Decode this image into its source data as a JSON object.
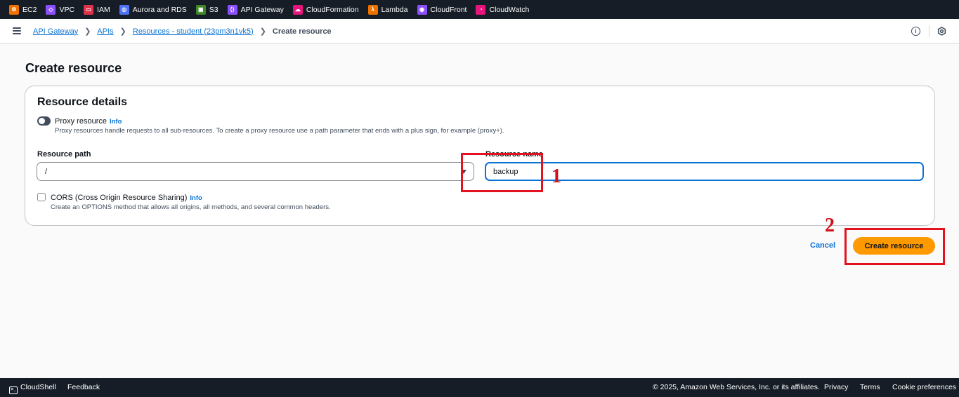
{
  "favorites": [
    {
      "label": "EC2",
      "icon": "ec2-icon",
      "color": "#ed7100"
    },
    {
      "label": "VPC",
      "icon": "vpc-icon",
      "color": "#8c4fff"
    },
    {
      "label": "IAM",
      "icon": "iam-icon",
      "color": "#dd344c"
    },
    {
      "label": "Aurora and RDS",
      "icon": "rds-icon",
      "color": "#4d72f3"
    },
    {
      "label": "S3",
      "icon": "s3-icon",
      "color": "#3f8624"
    },
    {
      "label": "API Gateway",
      "icon": "api-gateway-icon",
      "color": "#8c4fff"
    },
    {
      "label": "CloudFormation",
      "icon": "cloudformation-icon",
      "color": "#e7157b"
    },
    {
      "label": "Lambda",
      "icon": "lambda-icon",
      "color": "#ed7100"
    },
    {
      "label": "CloudFront",
      "icon": "cloudfront-icon",
      "color": "#8c4fff"
    },
    {
      "label": "CloudWatch",
      "icon": "cloudwatch-icon",
      "color": "#e7157b"
    }
  ],
  "breadcrumb": {
    "api_gateway": "API Gateway",
    "apis": "APIs",
    "resources": "Resources - student (23pm3n1vk5)",
    "current": "Create resource"
  },
  "page": {
    "title": "Create resource"
  },
  "resource_details": {
    "title": "Resource details",
    "proxy_label": "Proxy resource",
    "proxy_info": "Info",
    "proxy_desc": "Proxy resources handle requests to all sub-resources. To create a proxy resource use a path parameter that ends with a plus sign, for example (proxy+).",
    "proxy_enabled": false,
    "path_label": "Resource path",
    "path_value": "/",
    "name_label": "Resource name",
    "name_value": "backup",
    "cors_label": "CORS (Cross Origin Resource Sharing)",
    "cors_info": "Info",
    "cors_desc": "Create an OPTIONS method that allows all origins, all methods, and several common headers.",
    "cors_checked": false
  },
  "actions": {
    "cancel": "Cancel",
    "create": "Create resource"
  },
  "annotations": {
    "one": "1",
    "two": "2"
  },
  "footer": {
    "cloudshell": "CloudShell",
    "feedback": "Feedback",
    "copyright": "© 2025, Amazon Web Services, Inc. or its affiliates.",
    "privacy": "Privacy",
    "terms": "Terms",
    "cookies": "Cookie preferences"
  },
  "colors": {
    "accent": "#ff9900",
    "link": "#0972d3",
    "annotation": "#e4111f"
  }
}
